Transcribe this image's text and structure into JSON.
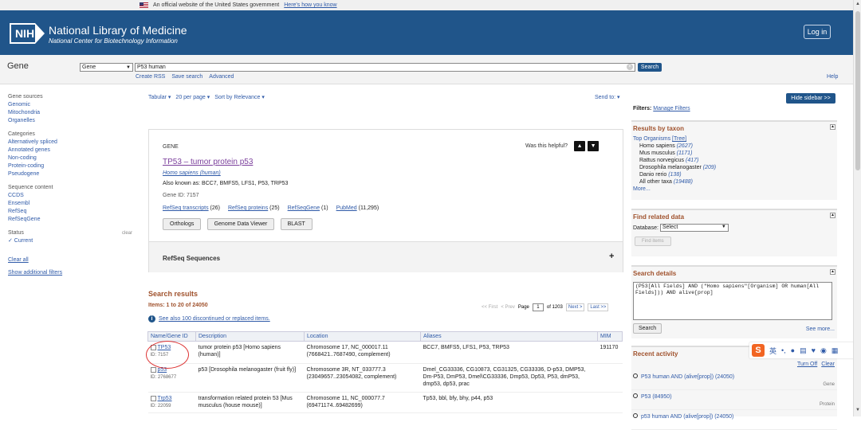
{
  "gov_banner": {
    "text": "An official website of the United States government",
    "link": "Here's how you know"
  },
  "header": {
    "logo": "NIH",
    "title": "National Library of Medicine",
    "subtitle": "National Center for Biotechnology Information",
    "login": "Log in"
  },
  "search": {
    "section_label": "Gene",
    "db_value": "Gene",
    "query": "P53 human",
    "button": "Search",
    "clear": "×",
    "links": [
      "Create RSS",
      "Save search",
      "Advanced"
    ],
    "help": "Help"
  },
  "sidebar": {
    "groups": [
      {
        "title": "Gene sources",
        "items": [
          "Genomic",
          "Mitochondria",
          "Organelles"
        ]
      },
      {
        "title": "Categories",
        "items": [
          "Alternatively spliced",
          "Annotated genes",
          "Non-coding",
          "Protein-coding",
          "Pseudogene"
        ]
      },
      {
        "title": "Sequence content",
        "items": [
          "CCDS",
          "Ensembl",
          "RefSeq",
          "RefSeqGene"
        ]
      }
    ],
    "status_title": "Status",
    "status_clear": "clear",
    "status_current": "✓ Current",
    "clear_all": "Clear all",
    "show_filters": "Show additional filters"
  },
  "toolbar": {
    "format": "Tabular ▾",
    "per_page": "20 per page ▾",
    "sort": "Sort by Relevance ▾",
    "send_to": "Send to: ▾"
  },
  "card": {
    "label": "GENE",
    "helpful": "Was this helpful?",
    "title": "TP53  –  tumor protein p53",
    "organism": "Homo sapiens (human)",
    "aliases": "Also known as: BCC7, BMFS5, LFS1, P53, TRP53",
    "gene_id": "Gene ID: 7157",
    "links": [
      {
        "label": "RefSeq transcripts",
        "count": " (26)"
      },
      {
        "label": "RefSeq proteins",
        "count": " (25)"
      },
      {
        "label": "RefSeqGene",
        "count": " (1)"
      },
      {
        "label": "PubMed",
        "count": " (11,295)"
      }
    ],
    "buttons": [
      "Orthologs",
      "Genome Data Viewer",
      "BLAST"
    ],
    "refseq": "RefSeq Sequences",
    "plus": "+"
  },
  "results": {
    "heading": "Search results",
    "count": "Items: 1 to 20 of 24050",
    "see_also": "See also 100 discontinued or replaced items.",
    "pager": {
      "first": "<< First",
      "prev": "< Prev",
      "page_label": "Page",
      "page": "1",
      "of": "of 1203",
      "next": "Next >",
      "last": "Last >>"
    },
    "columns": [
      "Name/Gene ID",
      "Description",
      "Location",
      "Aliases",
      "MIM"
    ],
    "rows": [
      {
        "name": "TP53",
        "id": "ID: 7157",
        "desc": "tumor protein p53 [Homo sapiens (human)]",
        "loc": "Chromosome 17, NC_000017.11 (7668421..7687490, complement)",
        "aliases": "BCC7, BMFS5, LFS1, P53, TRP53",
        "mim": "191170"
      },
      {
        "name": "p53",
        "id": "ID: 2768677",
        "desc": "p53 [Drosophila melanogaster (fruit fly)]",
        "loc": "Chromosome 3R, NT_033777.3 (23049657..23054082, complement)",
        "aliases": "Dmel_CG33336, CG10873, CG31325, CG33336, D-p53, DMP53, Dm-P53, DmP53, Dmel\\CG33336, Dmp53, Dp53, P53, dmP53, dmp53, dp53, prac",
        "mim": ""
      },
      {
        "name": "Trp53",
        "id": "ID: 22059",
        "desc": "transformation related protein 53 [Mus musculus (house mouse)]",
        "loc": "Chromosome 11, NC_000077.7 (69471174..69482699)",
        "aliases": "Tp53, bbl, bfy, bhy, p44, p53",
        "mim": ""
      }
    ]
  },
  "right": {
    "hide_sidebar": "Hide sidebar >>",
    "filters_label": "Filters:",
    "manage_filters": "Manage Filters",
    "taxon": {
      "title": "Results by taxon",
      "top": "Top Organisms",
      "tree": "[Tree]",
      "items": [
        {
          "name": "Homo sapiens",
          "count": "(2627)"
        },
        {
          "name": "Mus musculus",
          "count": "(1171)"
        },
        {
          "name": "Rattus norvegicus",
          "count": "(417)"
        },
        {
          "name": "Drosophila melanogaster",
          "count": "(209)"
        },
        {
          "name": "Danio rerio",
          "count": "(138)"
        },
        {
          "name": "All other taxa",
          "count": "(19488)"
        }
      ],
      "more": "More..."
    },
    "related": {
      "title": "Find related data",
      "db_label": "Database:",
      "db_value": "Select",
      "find": "Find items"
    },
    "details": {
      "title": "Search details",
      "query": "(P53[All Fields] AND (\"Homo sapiens\"[Organism] OR human[All Fields])) AND alive[prop]",
      "search": "Search",
      "see_more": "See more..."
    },
    "recent": {
      "title": "Recent activity",
      "turn_off": "Turn Off",
      "clear": "Clear",
      "items": [
        {
          "q": "P53 human AND (alive[prop]) (24050)",
          "db": "Gene"
        },
        {
          "q": "P53 (84950)",
          "db": "Protein"
        },
        {
          "q": "p53 human AND (alive[prop]) (24050)",
          "db": ""
        }
      ]
    }
  },
  "ime": {
    "logo": "S",
    "lang": "英"
  }
}
